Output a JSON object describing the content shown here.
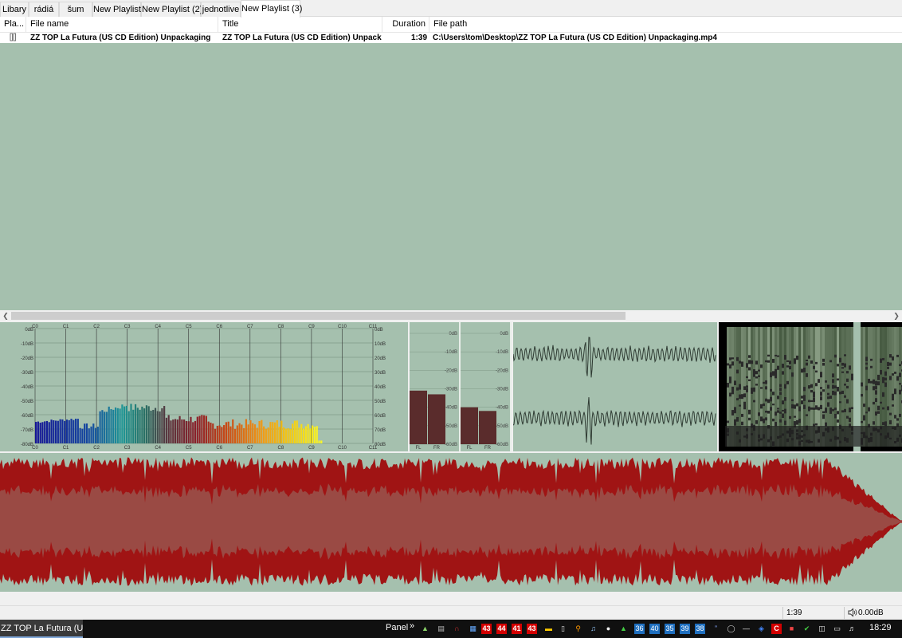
{
  "tabs": [
    {
      "label": "Libary",
      "active": false
    },
    {
      "label": "rádiá",
      "active": false
    },
    {
      "label": "šum",
      "active": false
    },
    {
      "label": "New Playlist",
      "active": false
    },
    {
      "label": "New Playlist (2)",
      "active": false
    },
    {
      "label": "jednotlive",
      "active": false
    },
    {
      "label": "New Playlist (3)",
      "active": true
    }
  ],
  "columns": {
    "playing": "Pla...",
    "file_name": "File name",
    "title": "Title",
    "duration": "Duration",
    "file_path": "File path"
  },
  "rows": [
    {
      "file_name": "ZZ TOP La Futura (US CD Edition) Unpackaging",
      "title": "ZZ TOP La Futura (US CD Edition) Unpacka...",
      "duration": "1:39",
      "file_path": "C:\\Users\\tom\\Desktop\\ZZ TOP La Futura (US CD Edition) Unpackaging.mp4"
    }
  ],
  "spectrum": {
    "notes": [
      "C0",
      "C1",
      "C2",
      "C3",
      "C4",
      "C5",
      "C6",
      "C7",
      "C8",
      "C9",
      "C10",
      "C11"
    ],
    "db_labels": [
      "0dB",
      "-10dB",
      "-20dB",
      "-30dB",
      "-40dB",
      "-50dB",
      "-60dB",
      "-70dB",
      "-80dB"
    ],
    "db_labels_right": [
      "0dB",
      "10dB",
      "20dB",
      "30dB",
      "40dB",
      "50dB",
      "60dB",
      "70dB",
      "80dB"
    ]
  },
  "peak_meter": {
    "db_labels": [
      "0dB",
      "10dB",
      "20dB",
      "30dB",
      "40dB",
      "50dB",
      "60dB"
    ],
    "meters": [
      {
        "channels": [
          "FL",
          "FR"
        ],
        "levels_db": [
          -31,
          -33
        ]
      },
      {
        "channels": [
          "FL",
          "FR"
        ],
        "levels_db": [
          -40,
          -42
        ]
      }
    ]
  },
  "status": {
    "time": "1:39",
    "volume": "0.00dB"
  },
  "taskbar": {
    "app": "ZZ TOP La Futura (US ...",
    "panel_label": "Panel",
    "badges_red": [
      "43",
      "44",
      "41",
      "43"
    ],
    "badges_blue": [
      "36",
      "40",
      "35",
      "39",
      "38"
    ],
    "clock": "18:29"
  },
  "colors": {
    "panel_bg": "#a5c0ae",
    "waveform": "#a01414",
    "peak_bar": "#5a2c2c"
  }
}
